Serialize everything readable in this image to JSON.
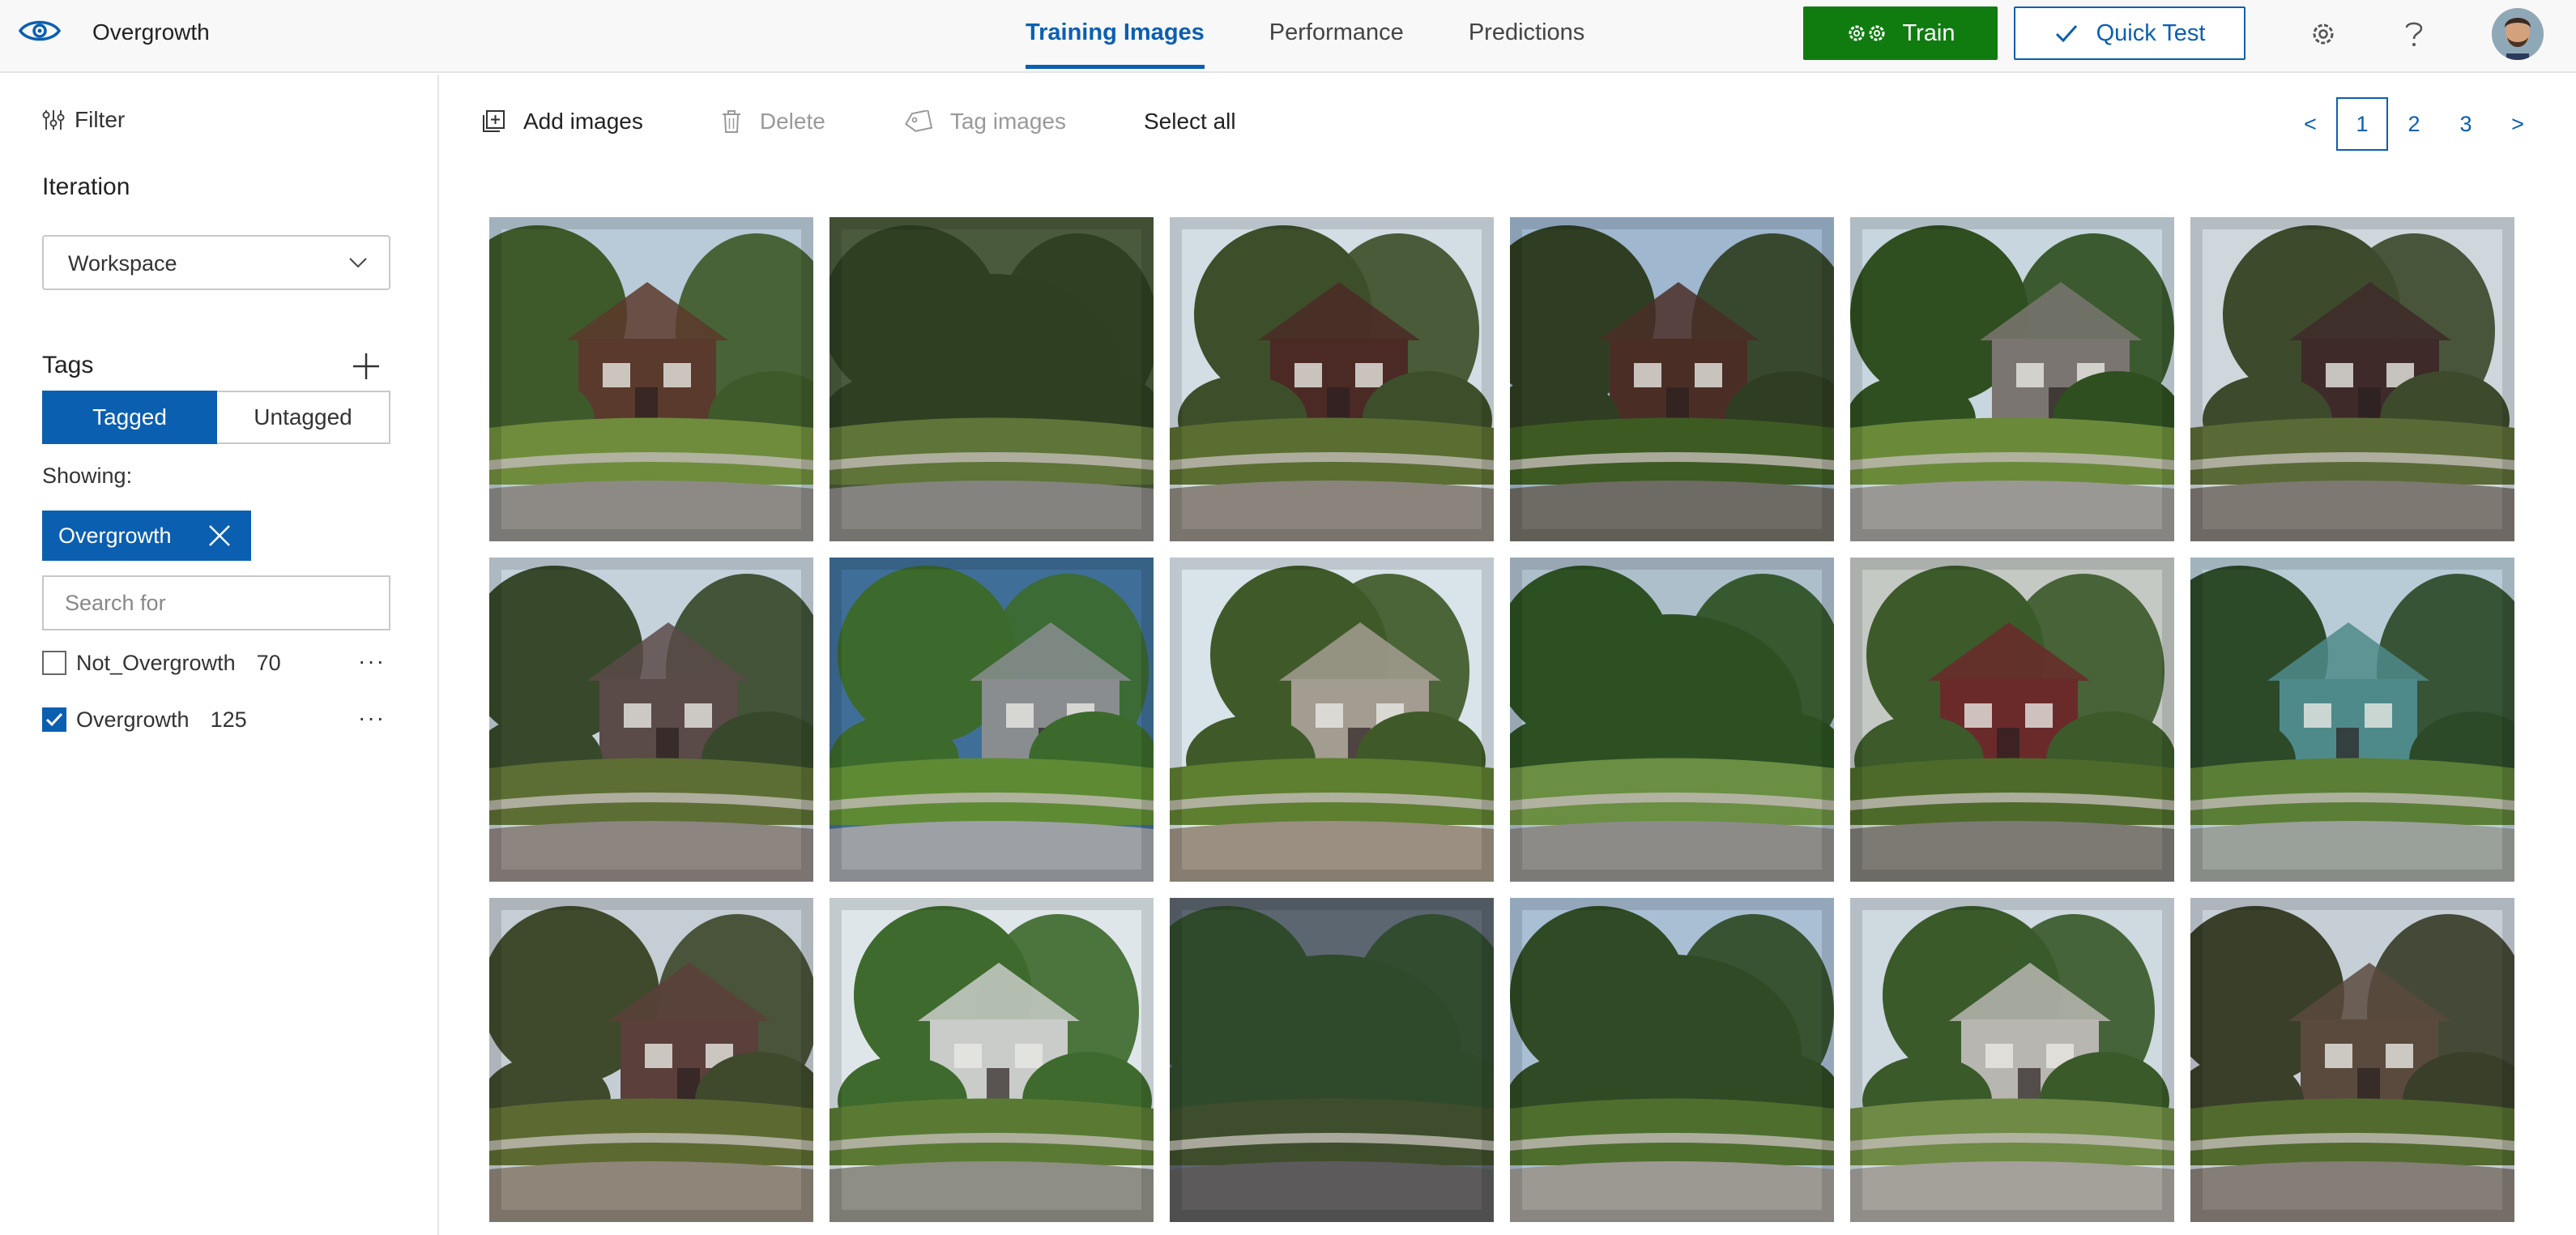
{
  "header": {
    "app_title": "Overgrowth",
    "tabs": [
      {
        "label": "Training Images",
        "active": true
      },
      {
        "label": "Performance",
        "active": false
      },
      {
        "label": "Predictions",
        "active": false
      }
    ],
    "train_label": "Train",
    "quick_test_label": "Quick Test",
    "accent_color": "#0b5fb0",
    "train_color": "#107c10"
  },
  "sidebar": {
    "filter_label": "Filter",
    "iteration_title": "Iteration",
    "iteration_value": "Workspace",
    "tags_title": "Tags",
    "tagged_label": "Tagged",
    "untagged_label": "Untagged",
    "showing_label": "Showing:",
    "active_filter_chip": "Overgrowth",
    "search_placeholder": "Search for",
    "tags": [
      {
        "name": "Not_Overgrowth",
        "count": "70",
        "checked": false
      },
      {
        "name": "Overgrowth",
        "count": "125",
        "checked": true
      }
    ]
  },
  "toolbar": {
    "add_images": "Add images",
    "delete": "Delete",
    "tag_images": "Tag images",
    "select_all": "Select all"
  },
  "pagination": {
    "prev": "<",
    "pages": [
      "1",
      "2",
      "3"
    ],
    "current": "1",
    "next": ">"
  },
  "images": [
    {
      "sky": "#b9cbd8",
      "foliage": "#3f5a2a",
      "house": "#5a3a2c",
      "grass": "#6f8c3c",
      "ground": "#8d8a86",
      "has_house": true
    },
    {
      "sky": "#4a5a3c",
      "foliage": "#2e3f22",
      "house": "#4a4436",
      "grass": "#5e7438",
      "ground": "#85837f",
      "has_house": false
    },
    {
      "sky": "#d3dde4",
      "foliage": "#3d4f2a",
      "house": "#4b2a26",
      "grass": "#5a6e32",
      "ground": "#8a847c",
      "has_house": true
    },
    {
      "sky": "#9fb7cf",
      "foliage": "#2f3e22",
      "house": "#4a2e26",
      "grass": "#3d5a22",
      "ground": "#6e6b64",
      "has_house": true
    },
    {
      "sky": "#c8d6df",
      "foliage": "#2f4f20",
      "house": "#7a7570",
      "grass": "#6a8a3a",
      "ground": "#9a9894",
      "has_house": true
    },
    {
      "sky": "#cfd7dd",
      "foliage": "#3d4a2c",
      "house": "#3f2a2a",
      "grass": "#5a6a36",
      "ground": "#7e7872",
      "has_house": true
    },
    {
      "sky": "#c5d2dc",
      "foliage": "#37492a",
      "house": "#5a4a48",
      "grass": "#5c6e34",
      "ground": "#8c8580",
      "has_house": true
    },
    {
      "sky": "#3f6f98",
      "foliage": "#3c6a2c",
      "house": "#8a8d90",
      "grass": "#5f8a34",
      "ground": "#9da1a5",
      "has_house": true
    },
    {
      "sky": "#d9e3ea",
      "foliage": "#3f5a28",
      "house": "#a39c90",
      "grass": "#5e7e30",
      "ground": "#9a8f80",
      "has_house": true
    },
    {
      "sky": "#aebfcc",
      "foliage": "#2c5022",
      "house": "#6a7a5a",
      "grass": "#6a8e42",
      "ground": "#8d8b88",
      "has_house": false
    },
    {
      "sky": "#c4c9c4",
      "foliage": "#3c5a2a",
      "house": "#6a2a2a",
      "grass": "#4e6a2a",
      "ground": "#7d7a74",
      "has_house": true
    },
    {
      "sky": "#b8ccd8",
      "foliage": "#2c4a28",
      "house": "#4f8a8a",
      "grass": "#5a7e36",
      "ground": "#9aa09a",
      "has_house": true
    },
    {
      "sky": "#c5ced4",
      "foliage": "#3f4a2c",
      "house": "#5a3f3a",
      "grass": "#5c6a32",
      "ground": "#8f8578",
      "has_house": true
    },
    {
      "sky": "#dfe6ea",
      "foliage": "#3f6a2e",
      "house": "#c9ccc8",
      "grass": "#5a7a34",
      "ground": "#8e8e84",
      "has_house": true
    },
    {
      "sky": "#5c6670",
      "foliage": "#2f4a2a",
      "house": "#3a3a3e",
      "grass": "#3e4e2c",
      "ground": "#5c5a5a",
      "has_house": false
    },
    {
      "sky": "#a9bfd4",
      "foliage": "#2f4a24",
      "house": "#6a4a3e",
      "grass": "#4e6e2e",
      "ground": "#9c9892",
      "has_house": false
    },
    {
      "sky": "#cfd9e0",
      "foliage": "#3a5a2a",
      "house": "#b8b6b0",
      "grass": "#6e8a44",
      "ground": "#a4a09a",
      "has_house": true
    },
    {
      "sky": "#c7cfd6",
      "foliage": "#3a3f2a",
      "house": "#5a4a3e",
      "grass": "#526a2e",
      "ground": "#847e76",
      "has_house": true
    }
  ]
}
